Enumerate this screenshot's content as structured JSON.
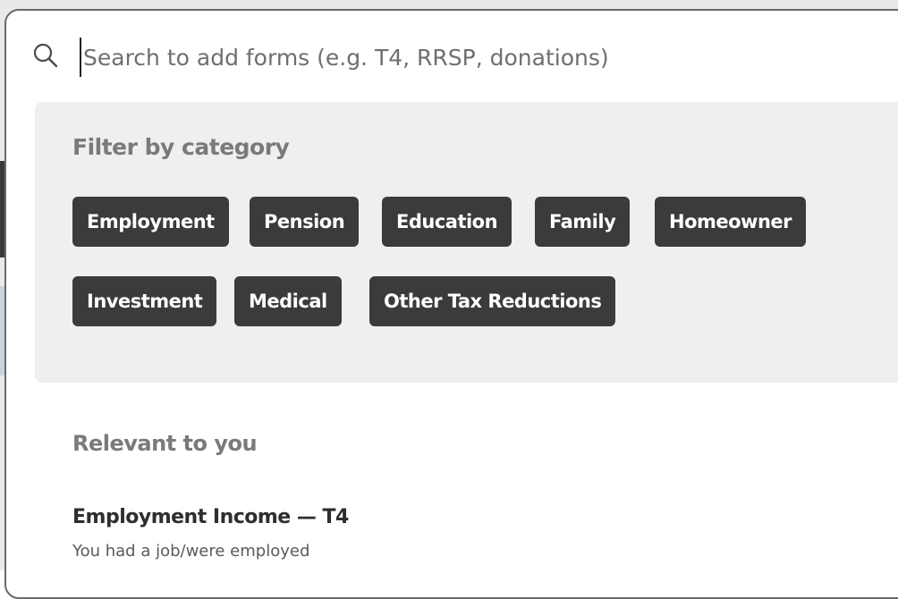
{
  "search": {
    "placeholder": "Search to add forms (e.g. T4, RRSP, donations)",
    "value": ""
  },
  "filter": {
    "heading": "Filter by category",
    "categories": [
      {
        "label": "Employment"
      },
      {
        "label": "Pension"
      },
      {
        "label": "Education"
      },
      {
        "label": "Family"
      },
      {
        "label": "Homeowner"
      },
      {
        "label": "Investment"
      },
      {
        "label": "Medical"
      },
      {
        "label": "Other Tax Reductions"
      }
    ]
  },
  "relevant": {
    "heading": "Relevant to you",
    "items": [
      {
        "title": "Employment Income — T4",
        "subtitle": "You had a job/were employed"
      }
    ]
  },
  "colors": {
    "chip_bg": "#3d3b39",
    "chip_text": "#ffffff",
    "panel_bg": "#efefef",
    "heading_gray": "#7a7a7a"
  },
  "icons": {
    "search": "search-icon"
  }
}
